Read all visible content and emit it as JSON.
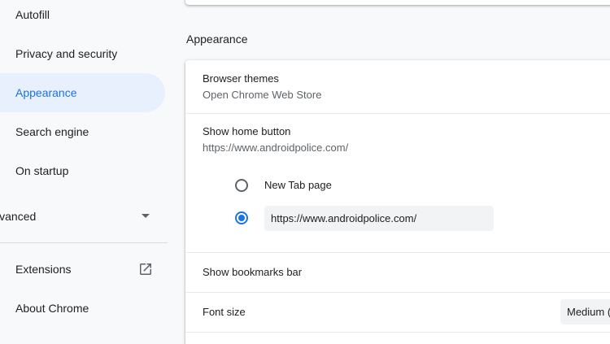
{
  "sidebar": {
    "items": [
      {
        "label": "Autofill"
      },
      {
        "label": "Privacy and security"
      },
      {
        "label": "Appearance"
      },
      {
        "label": "Search engine"
      },
      {
        "label": "On startup"
      }
    ],
    "advanced_label": "Advanced",
    "extensions_label": "Extensions",
    "about_label": "About Chrome",
    "active_item": "Appearance"
  },
  "main": {
    "section_title": "Appearance",
    "browser_themes": {
      "title": "Browser themes",
      "subtitle": "Open Chrome Web Store"
    },
    "home_button": {
      "title": "Show home button",
      "subtitle": "https://www.androidpolice.com/",
      "options": [
        {
          "label": "New Tab page",
          "selected": false
        },
        {
          "value": "https://www.androidpolice.com/",
          "selected": true
        }
      ]
    },
    "bookmarks_bar": {
      "title": "Show bookmarks bar"
    },
    "font_size": {
      "title": "Font size",
      "selected": "Medium (recommended)"
    }
  },
  "colors": {
    "accent": "#1a73e8",
    "active_nav_bg": "#e8f0fe",
    "page_bg": "#f8f9fa",
    "card_bg": "#ffffff"
  },
  "icons": {
    "extensions": "open-in-new-icon",
    "advanced": "caret-down-icon"
  }
}
